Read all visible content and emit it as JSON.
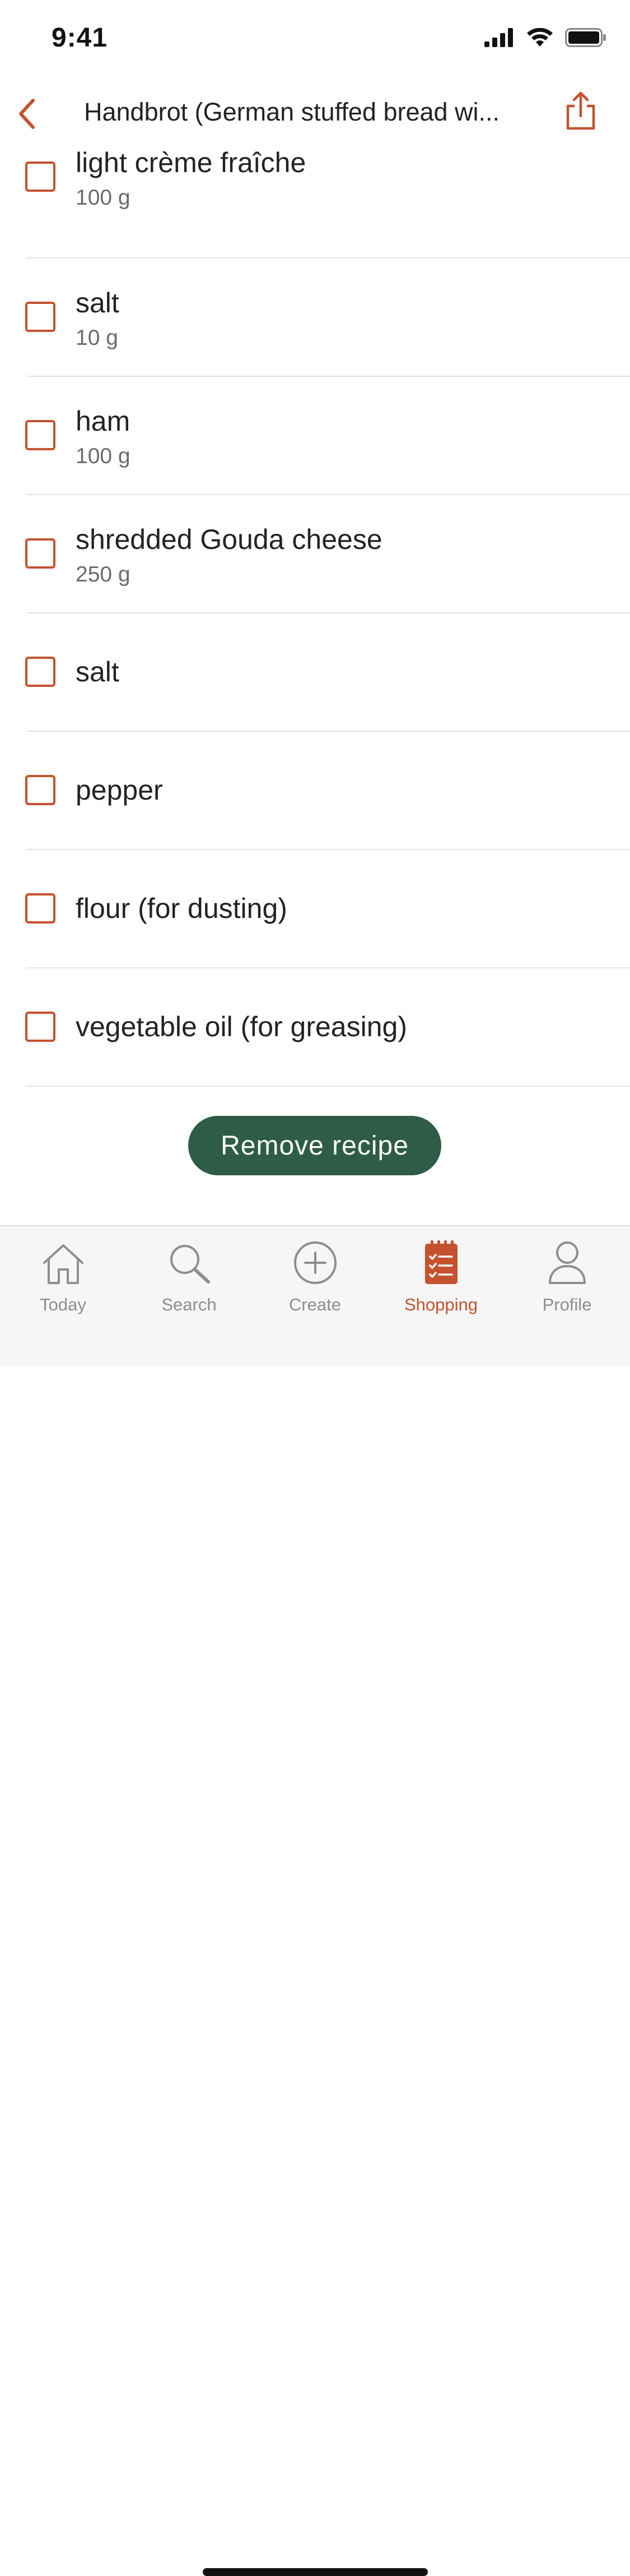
{
  "status_bar": {
    "time": "9:41"
  },
  "nav": {
    "title": "Handbrot (German stuffed bread wi...",
    "back_icon": "chevron-left-icon",
    "share_icon": "share-icon"
  },
  "ingredients": [
    {
      "name": "light crème fraîche",
      "quantity": "100 g",
      "checked": false
    },
    {
      "name": "salt",
      "quantity": "10 g",
      "checked": false
    },
    {
      "name": "ham",
      "quantity": "100 g",
      "checked": false
    },
    {
      "name": "shredded Gouda cheese",
      "quantity": "250 g",
      "checked": false
    },
    {
      "name": "salt",
      "quantity": "",
      "checked": false
    },
    {
      "name": "pepper",
      "quantity": "",
      "checked": false
    },
    {
      "name": "flour (for dusting)",
      "quantity": "",
      "checked": false
    },
    {
      "name": "vegetable oil (for greasing)",
      "quantity": "",
      "checked": false
    }
  ],
  "remove_button": {
    "label": "Remove recipe"
  },
  "tab_bar": {
    "tabs": [
      {
        "label": "Today",
        "icon": "home-icon",
        "active": false
      },
      {
        "label": "Search",
        "icon": "search-icon",
        "active": false
      },
      {
        "label": "Create",
        "icon": "plus-circle-icon",
        "active": false
      },
      {
        "label": "Shopping",
        "icon": "shopping-list-icon",
        "active": true
      },
      {
        "label": "Profile",
        "icon": "profile-icon",
        "active": false
      }
    ]
  },
  "colors": {
    "accent": "#c4522e",
    "button": "#2e5c47",
    "tab_inactive": "#8e8e8e",
    "divider": "#e4e4e4"
  }
}
